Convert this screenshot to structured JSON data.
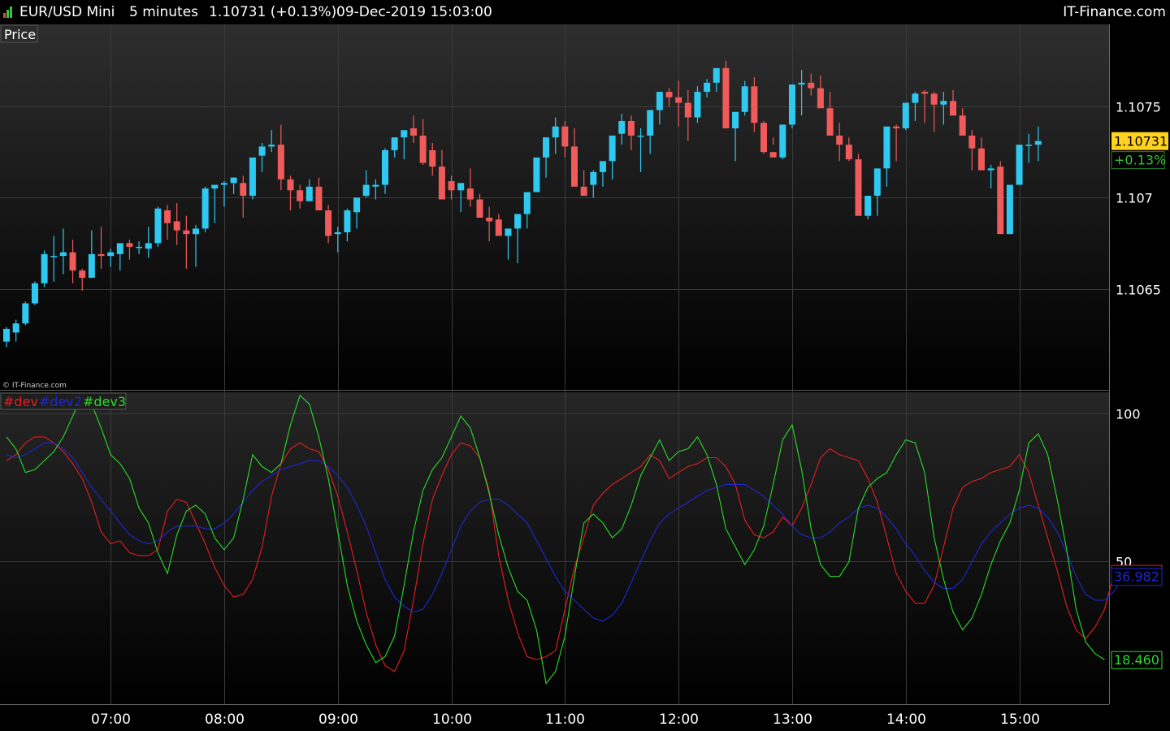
{
  "header": {
    "instrument": "EUR/USD Mini",
    "timeframe": "5 minutes",
    "price_change": "1.10731 (+0.13%)",
    "datetime": "09-Dec-2019 15:03:00",
    "brand": "IT-Finance.com"
  },
  "colors": {
    "bull": "#2fc8f0",
    "bear": "#f05a5a",
    "dev": "#e61e1e",
    "dev2": "#1e28d2",
    "dev3": "#28dc28",
    "price_box": "#ffd21e",
    "grid": "#3a3a3a"
  },
  "chart_data": [
    {
      "type": "candlestick",
      "title": "Price",
      "watermark": "© IT-Finance.com",
      "y_ticks": [
        "1.1065",
        "1.107",
        "1.1075"
      ],
      "y_tick_values": [
        1.1065,
        1.107,
        1.1075
      ],
      "ylim": [
        1.10595,
        1.10795
      ],
      "last_price_label": "1.10731",
      "last_change_label": "+0.13%",
      "last_price": 1.10731,
      "x_ticks": [
        "07:00",
        "08:00",
        "09:00",
        "10:00",
        "11:00",
        "12:00",
        "13:00",
        "14:00",
        "15:00"
      ],
      "time_start": "06:05",
      "interval_minutes": 5,
      "candles": [
        [
          1.10621,
          1.10629,
          1.10618,
          1.10628
        ],
        [
          1.10626,
          1.10633,
          1.10621,
          1.10631
        ],
        [
          1.10631,
          1.10643,
          1.1063,
          1.10642
        ],
        [
          1.10642,
          1.10654,
          1.10641,
          1.10653
        ],
        [
          1.10653,
          1.10671,
          1.10651,
          1.10669
        ],
        [
          1.10668,
          1.10679,
          1.10654,
          1.10668
        ],
        [
          1.10668,
          1.10683,
          1.10658,
          1.1067
        ],
        [
          1.1067,
          1.10677,
          1.10653,
          1.1066
        ],
        [
          1.1066,
          1.10661,
          1.10649,
          1.10656
        ],
        [
          1.10656,
          1.10682,
          1.10656,
          1.10669
        ],
        [
          1.10669,
          1.10684,
          1.10661,
          1.10668
        ],
        [
          1.10668,
          1.10672,
          1.10662,
          1.1067
        ],
        [
          1.10669,
          1.10674,
          1.1066,
          1.10675
        ],
        [
          1.10675,
          1.10677,
          1.10666,
          1.10673
        ],
        [
          1.10673,
          1.10676,
          1.10669,
          1.10673
        ],
        [
          1.10672,
          1.10684,
          1.10667,
          1.10675
        ],
        [
          1.10675,
          1.10695,
          1.10673,
          1.10694
        ],
        [
          1.10693,
          1.10696,
          1.10677,
          1.10686
        ],
        [
          1.10687,
          1.10697,
          1.10674,
          1.10682
        ],
        [
          1.10682,
          1.1069,
          1.10661,
          1.1068
        ],
        [
          1.1068,
          1.10685,
          1.10662,
          1.10683
        ],
        [
          1.10683,
          1.10706,
          1.10681,
          1.10705
        ],
        [
          1.10705,
          1.10706,
          1.10686,
          1.10707
        ],
        [
          1.10707,
          1.10709,
          1.10695,
          1.10708
        ],
        [
          1.10708,
          1.10711,
          1.10702,
          1.10711
        ],
        [
          1.10708,
          1.10712,
          1.10689,
          1.10701
        ],
        [
          1.10701,
          1.1072,
          1.10699,
          1.10722
        ],
        [
          1.10723,
          1.1073,
          1.10714,
          1.10728
        ],
        [
          1.10728,
          1.10737,
          1.10725,
          1.10729
        ],
        [
          1.10729,
          1.1074,
          1.10704,
          1.1071
        ],
        [
          1.1071,
          1.10712,
          1.10693,
          1.10704
        ],
        [
          1.10704,
          1.10707,
          1.10694,
          1.10698
        ],
        [
          1.10698,
          1.1071,
          1.10701,
          1.10706
        ],
        [
          1.10706,
          1.10711,
          1.107,
          1.10693
        ],
        [
          1.10693,
          1.10696,
          1.10675,
          1.10679
        ],
        [
          1.1068,
          1.10684,
          1.1067,
          1.10681
        ],
        [
          1.10681,
          1.10694,
          1.10676,
          1.10693
        ],
        [
          1.10692,
          1.10697,
          1.10683,
          1.107
        ],
        [
          1.10701,
          1.10715,
          1.107,
          1.10707
        ],
        [
          1.10706,
          1.1071,
          1.10699,
          1.10707
        ],
        [
          1.10707,
          1.10727,
          1.10702,
          1.10726
        ],
        [
          1.10726,
          1.10732,
          1.10722,
          1.10733
        ],
        [
          1.10733,
          1.10734,
          1.10721,
          1.10737
        ],
        [
          1.10738,
          1.10745,
          1.1073,
          1.10734
        ],
        [
          1.10734,
          1.10743,
          1.10718,
          1.10719
        ],
        [
          1.10726,
          1.1073,
          1.10712,
          1.10717
        ],
        [
          1.10717,
          1.10726,
          1.10712,
          1.10699
        ],
        [
          1.10709,
          1.10712,
          1.10699,
          1.10704
        ],
        [
          1.10704,
          1.10708,
          1.10692,
          1.10708
        ],
        [
          1.10705,
          1.10716,
          1.10695,
          1.10699
        ],
        [
          1.10699,
          1.10702,
          1.1069,
          1.10689
        ],
        [
          1.10689,
          1.10695,
          1.10676,
          1.10687
        ],
        [
          1.10688,
          1.10691,
          1.10682,
          1.10679
        ],
        [
          1.10679,
          1.10682,
          1.10666,
          1.10683
        ],
        [
          1.10683,
          1.10688,
          1.10664,
          1.10691
        ],
        [
          1.10691,
          1.10702,
          1.10683,
          1.10703
        ],
        [
          1.10703,
          1.1072,
          1.10703,
          1.10722
        ],
        [
          1.10722,
          1.10733,
          1.10711,
          1.10733
        ],
        [
          1.10733,
          1.10744,
          1.10724,
          1.10739
        ],
        [
          1.10739,
          1.10742,
          1.10722,
          1.10728
        ],
        [
          1.10728,
          1.10738,
          1.10711,
          1.10706
        ],
        [
          1.10706,
          1.10715,
          1.10705,
          1.10701
        ],
        [
          1.10707,
          1.10715,
          1.107,
          1.10714
        ],
        [
          1.10714,
          1.1072,
          1.10706,
          1.1072
        ],
        [
          1.1072,
          1.10725,
          1.1071,
          1.10734
        ],
        [
          1.10735,
          1.10746,
          1.10729,
          1.10742
        ],
        [
          1.10742,
          1.10745,
          1.10726,
          1.10734
        ],
        [
          1.10734,
          1.10738,
          1.10714,
          1.10734
        ],
        [
          1.10734,
          1.1074,
          1.10724,
          1.10748
        ],
        [
          1.10748,
          1.10752,
          1.1074,
          1.10758
        ],
        [
          1.10758,
          1.1076,
          1.1075,
          1.10755
        ],
        [
          1.10755,
          1.10764,
          1.10739,
          1.10752
        ],
        [
          1.10752,
          1.10759,
          1.10731,
          1.10744
        ],
        [
          1.10744,
          1.10761,
          1.10741,
          1.10758
        ],
        [
          1.10758,
          1.10765,
          1.10755,
          1.10763
        ],
        [
          1.10763,
          1.10767,
          1.10758,
          1.10771
        ],
        [
          1.10771,
          1.10775,
          1.10745,
          1.10738
        ],
        [
          1.10738,
          1.10745,
          1.1072,
          1.10747
        ],
        [
          1.10747,
          1.10764,
          1.10745,
          1.10761
        ],
        [
          1.10761,
          1.10766,
          1.10736,
          1.10741
        ],
        [
          1.10741,
          1.10742,
          1.10724,
          1.10725
        ],
        [
          1.10725,
          1.10733,
          1.10729,
          1.10722
        ],
        [
          1.10722,
          1.10738,
          1.10721,
          1.1074
        ],
        [
          1.1074,
          1.10761,
          1.10738,
          1.10762
        ],
        [
          1.10762,
          1.1077,
          1.10745,
          1.10763
        ],
        [
          1.10763,
          1.10768,
          1.10756,
          1.1076
        ],
        [
          1.1076,
          1.10767,
          1.10753,
          1.10749
        ],
        [
          1.10749,
          1.10758,
          1.1074,
          1.10734
        ],
        [
          1.10734,
          1.10741,
          1.1072,
          1.10729
        ],
        [
          1.10729,
          1.10733,
          1.1072,
          1.10721
        ],
        [
          1.10721,
          1.10724,
          1.107,
          1.1069
        ],
        [
          1.1069,
          1.10692,
          1.10688,
          1.10701
        ],
        [
          1.10701,
          1.10704,
          1.1069,
          1.10716
        ],
        [
          1.10716,
          1.10729,
          1.10706,
          1.10739
        ],
        [
          1.10739,
          1.1074,
          1.1072,
          1.10738
        ],
        [
          1.10738,
          1.10749,
          1.10737,
          1.10752
        ],
        [
          1.10752,
          1.10758,
          1.10742,
          1.10757
        ],
        [
          1.10758,
          1.10759,
          1.10741,
          1.10757
        ],
        [
          1.10757,
          1.10758,
          1.10736,
          1.10751
        ],
        [
          1.10751,
          1.10758,
          1.1074,
          1.10753
        ],
        [
          1.10753,
          1.10759,
          1.10746,
          1.10745
        ],
        [
          1.10745,
          1.10749,
          1.1074,
          1.10734
        ],
        [
          1.10734,
          1.10737,
          1.10715,
          1.10727
        ],
        [
          1.10727,
          1.10733,
          1.10722,
          1.10715
        ],
        [
          1.10715,
          1.10718,
          1.10705,
          1.10716
        ],
        [
          1.10717,
          1.1072,
          1.10692,
          1.1068
        ],
        [
          1.1068,
          1.10689,
          1.10683,
          1.10707
        ],
        [
          1.10707,
          1.10712,
          1.10707,
          1.10729
        ],
        [
          1.10729,
          1.10735,
          1.10719,
          1.10729
        ],
        [
          1.10729,
          1.10739,
          1.1072,
          1.10731
        ]
      ]
    },
    {
      "type": "line",
      "legend": [
        "#dev",
        "#dev2",
        "#dev3"
      ],
      "y_ticks": [
        "100",
        "50"
      ],
      "y_tick_values": [
        100,
        50
      ],
      "ylim": [
        2,
        107
      ],
      "last_labels": [
        "46.243",
        "36.982",
        "18.460"
      ],
      "series": [
        {
          "name": "#dev",
          "values": [
            84,
            86,
            90,
            92,
            92,
            90,
            87,
            83,
            78,
            70,
            60,
            56,
            57,
            53,
            52,
            52,
            54,
            67,
            71,
            70,
            63,
            56,
            48,
            42,
            38,
            39,
            44,
            55,
            72,
            83,
            88,
            90,
            88,
            87,
            81,
            72,
            60,
            47,
            33,
            22,
            15,
            13,
            20,
            37,
            56,
            71,
            79,
            86,
            90,
            89,
            85,
            74,
            52,
            37,
            26,
            18,
            17,
            18,
            20,
            34,
            48,
            58,
            69,
            73,
            76,
            78,
            80,
            82,
            86,
            84,
            78,
            80,
            82,
            83,
            85,
            85,
            82,
            76,
            64,
            59,
            58,
            60,
            65,
            62,
            68,
            76,
            85,
            88,
            86,
            85,
            84,
            78,
            70,
            58,
            46,
            40,
            36,
            36,
            42,
            55,
            68,
            75,
            77,
            78,
            80,
            81,
            82,
            86,
            80,
            69,
            58,
            47,
            35,
            27,
            24,
            28,
            34,
            46
          ]
        },
        {
          "name": "#dev2",
          "values": [
            86,
            85,
            86,
            88,
            90,
            90,
            88,
            85,
            80,
            75,
            71,
            67,
            63,
            59,
            57,
            56,
            57,
            60,
            62,
            62,
            62,
            61,
            61,
            63,
            66,
            70,
            74,
            77,
            79,
            81,
            82,
            83,
            84,
            84,
            82,
            79,
            75,
            69,
            62,
            53,
            44,
            38,
            35,
            33,
            34,
            39,
            46,
            54,
            62,
            67,
            70,
            71,
            71,
            69,
            66,
            63,
            57,
            51,
            45,
            40,
            37,
            34,
            31,
            30,
            32,
            36,
            43,
            50,
            57,
            63,
            66,
            68,
            70,
            72,
            74,
            75,
            76,
            76,
            76,
            74,
            72,
            69,
            66,
            62,
            59,
            58,
            58,
            60,
            63,
            65,
            68,
            69,
            68,
            65,
            61,
            56,
            52,
            47,
            43,
            41,
            41,
            44,
            50,
            56,
            60,
            63,
            66,
            68,
            69,
            68,
            65,
            60,
            53,
            45,
            39,
            37,
            37,
            40,
            45
          ]
        },
        {
          "name": "#dev3",
          "values": [
            92,
            88,
            80,
            81,
            84,
            87,
            92,
            99,
            106,
            103,
            95,
            86,
            83,
            78,
            68,
            63,
            53,
            46,
            59,
            67,
            69,
            66,
            58,
            54,
            58,
            71,
            86,
            82,
            80,
            83,
            96,
            106,
            103,
            92,
            78,
            60,
            42,
            30,
            22,
            16,
            18,
            25,
            42,
            60,
            74,
            81,
            85,
            92,
            99,
            95,
            85,
            73,
            59,
            48,
            40,
            37,
            27,
            9,
            13,
            25,
            45,
            63,
            66,
            63,
            58,
            61,
            69,
            79,
            85,
            91,
            84,
            87,
            88,
            92,
            86,
            76,
            61,
            55,
            49,
            54,
            62,
            76,
            91,
            96,
            81,
            61,
            49,
            45,
            45,
            50,
            68,
            75,
            78,
            80,
            86,
            91,
            90,
            80,
            58,
            44,
            33,
            27,
            31,
            39,
            49,
            57,
            63,
            74,
            90,
            93,
            86,
            71,
            54,
            34,
            23,
            19,
            17
          ]
        }
      ]
    }
  ]
}
